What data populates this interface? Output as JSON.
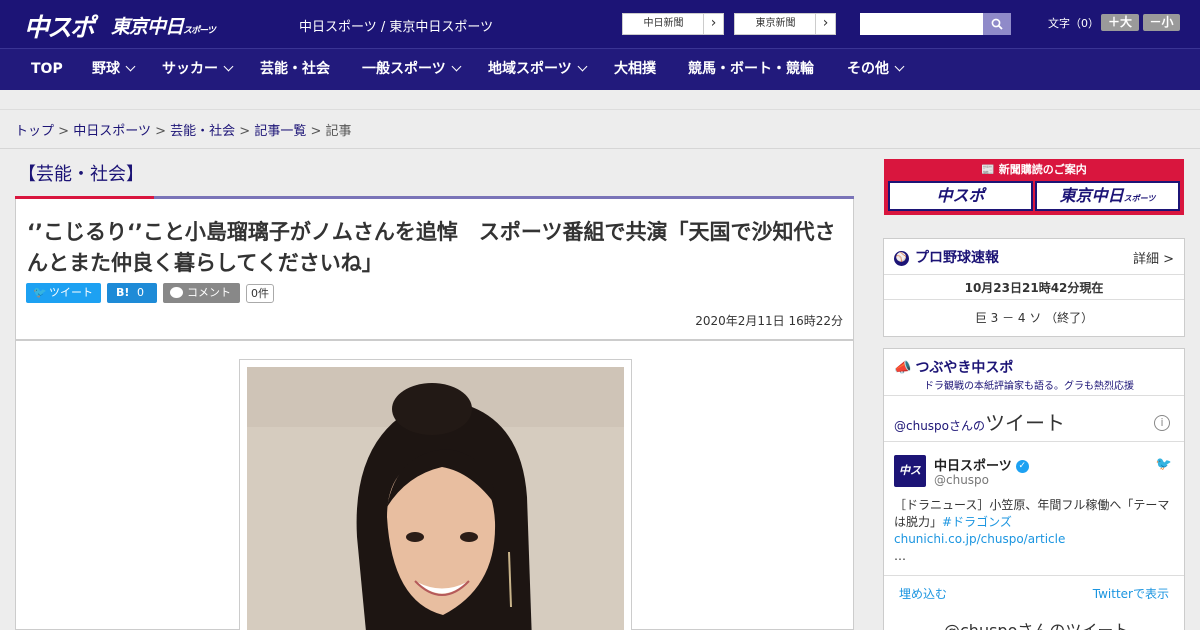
{
  "header": {
    "logo_main": "中スポ",
    "logo_tokyo": "東京中日",
    "logo_tokyo_small": "スポーツ",
    "site_name": "中日スポーツ / 東京中日スポーツ",
    "btn_chunichi": "中日新聞",
    "btn_tokyo": "東京新聞",
    "search_placeholder": "",
    "font_size_label": "文字（0）",
    "font_larger": "＋大",
    "font_smaller": "－小"
  },
  "nav": {
    "items": [
      {
        "label": "TOP",
        "dropdown": false
      },
      {
        "label": "野球",
        "dropdown": true
      },
      {
        "label": "サッカー",
        "dropdown": true
      },
      {
        "label": "芸能・社会",
        "dropdown": false
      },
      {
        "label": "一般スポーツ",
        "dropdown": true
      },
      {
        "label": "地域スポーツ",
        "dropdown": true
      },
      {
        "label": "大相撲",
        "dropdown": false
      },
      {
        "label": "競馬・ボート・競輪",
        "dropdown": false
      },
      {
        "label": "その他",
        "dropdown": true
      }
    ]
  },
  "breadcrumb": {
    "items": [
      "トップ",
      "中日スポーツ",
      "芸能・社会",
      "記事一覧"
    ],
    "current": "記事",
    "separator": ">"
  },
  "article": {
    "category": "【芸能・社会】",
    "headline": "‘’こじるり‘’こと小島瑠璃子がノムさんを追悼　スポーツ番組で共演「天国で沙知代さんとまた仲良く暮らしてくださいね」",
    "tweet_label": "ツイート",
    "hatena_label": "B!",
    "hatena_count": "0",
    "comment_label": "コメント",
    "comment_count": "0件",
    "date": "2020年2月11日 16時22分"
  },
  "sidebar": {
    "ad_head": "新聞購読のご案内",
    "ad_btn1": "中スポ",
    "ad_btn2": "東京中日",
    "ad_btn2_small": "スポーツ",
    "baseball_title": "プロ野球速報",
    "baseball_detail": "詳細 >",
    "baseball_time": "10月23日21時42分現在",
    "baseball_score": "巨 3 － 4 ソ （終了）",
    "tsubuyaki_title": "つぶやき中スポ",
    "tsubuyaki_sub": "ドラ観戦の本紙評論家も語る。グラも熱烈応援",
    "tweet_head_handle": "@chuspoさんの",
    "tweet_head_label": "ツイート",
    "avatar_text": "中スポ",
    "account_name": "中日スポーツ",
    "account_handle": "@chuspo",
    "tweet_text_plain": "［ドラニュース］小笠原、年間フル稼働へ「テーマは脱力」",
    "tweet_text_link": "#ドラゴンズ chunichi.co.jp/chuspo/article",
    "tweet_text_more": "…",
    "embed_label": "埋め込む",
    "view_label": "Twitterで表示",
    "footer_label": "@chuspoさんのツイート"
  },
  "colors": {
    "brand": "#1c1476",
    "accent_red": "#d9163e",
    "twitter": "#1da1f2"
  }
}
